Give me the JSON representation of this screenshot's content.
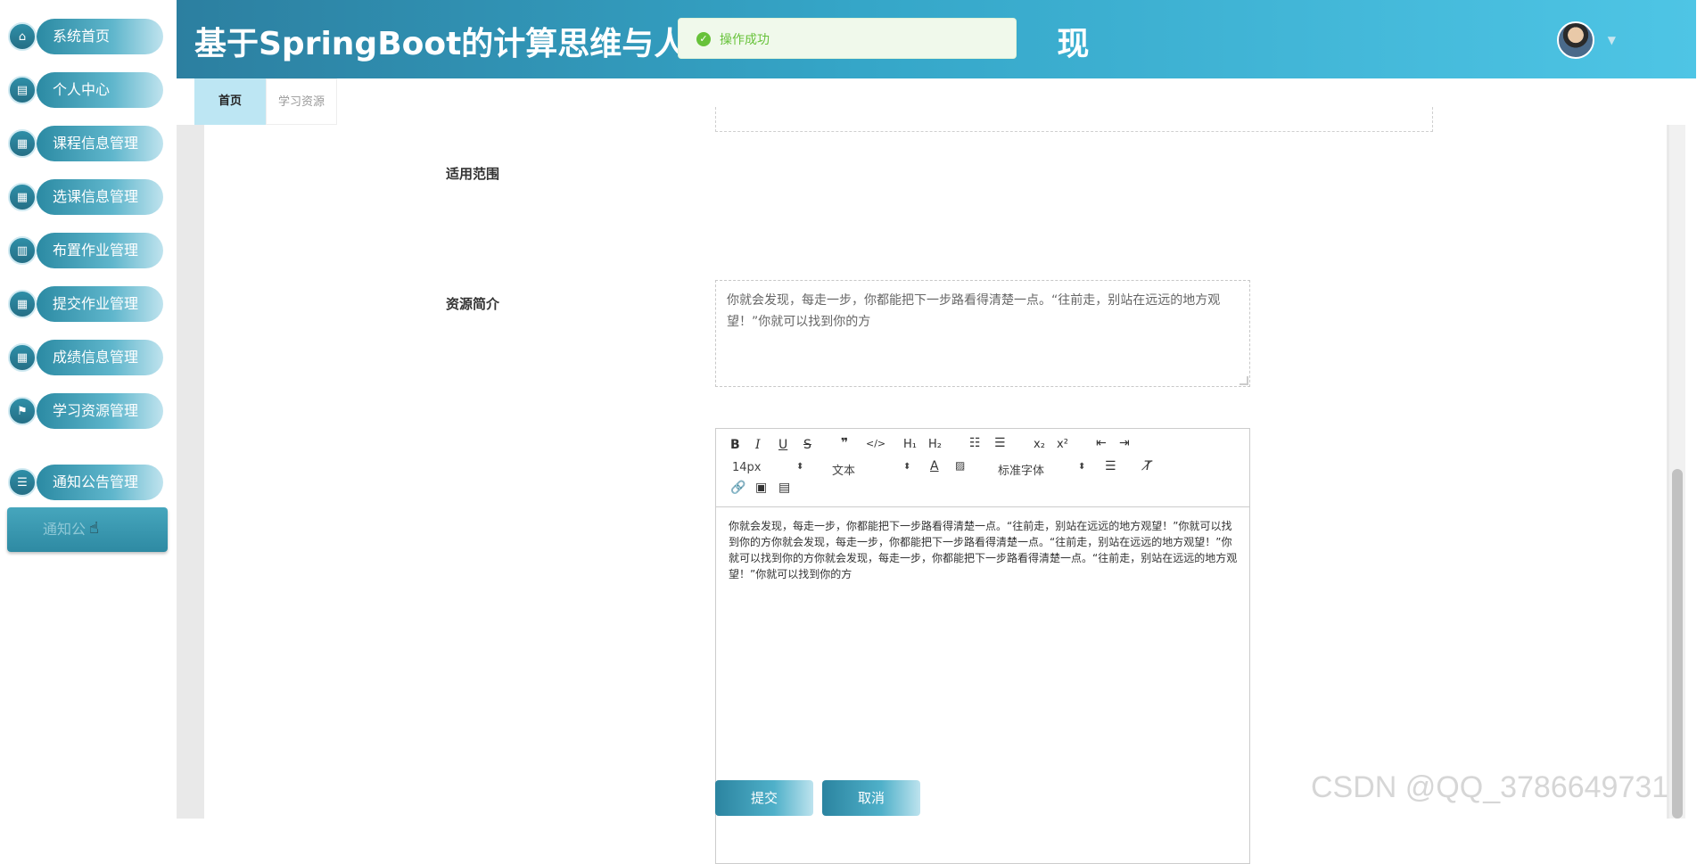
{
  "sidebar": {
    "items": [
      {
        "label": "系统首页",
        "icon": "home-icon"
      },
      {
        "label": "个人中心",
        "icon": "profile-icon"
      },
      {
        "label": "课程信息管理",
        "icon": "grid-icon"
      },
      {
        "label": "选课信息管理",
        "icon": "grid-icon"
      },
      {
        "label": "布置作业管理",
        "icon": "books-icon"
      },
      {
        "label": "提交作业管理",
        "icon": "grid-icon"
      },
      {
        "label": "成绩信息管理",
        "icon": "grid-icon"
      },
      {
        "label": "学习资源管理",
        "icon": "flag-icon"
      },
      {
        "label": "通知公告管理",
        "icon": "list-icon"
      }
    ],
    "submenu_label": "通知公"
  },
  "header": {
    "title": "基于SpringBoot的计算思维与人工",
    "title_tail": "现"
  },
  "toast": {
    "text": "操作成功"
  },
  "tabs": [
    {
      "label": "首页",
      "active": true
    },
    {
      "label": "学习资源",
      "active": false
    }
  ],
  "form": {
    "scope_label": "适用范围",
    "scope_value": "你就会发现，每走一步，你都能把下一步路看得清楚一点。“往前走，别站在远远的地方观望！”你就可以找到你的方",
    "intro_label": "资源简介",
    "toolbar": {
      "font_size": "14px",
      "paragraph": "文本",
      "font_family": "标准字体"
    },
    "intro_content": "你就会发现，每走一步，你都能把下一步路看得清楚一点。“往前走，别站在远远的地方观望！”你就可以找到你的方你就会发现，每走一步，你都能把下一步路看得清楚一点。“往前走，别站在远远的地方观望！”你就可以找到你的方你就会发现，每走一步，你都能把下一步路看得清楚一点。“往前走，别站在远远的地方观望！”你就可以找到你的方",
    "submit_label": "提交",
    "cancel_label": "取消"
  },
  "watermark": "CSDN @QQ_3786649731"
}
